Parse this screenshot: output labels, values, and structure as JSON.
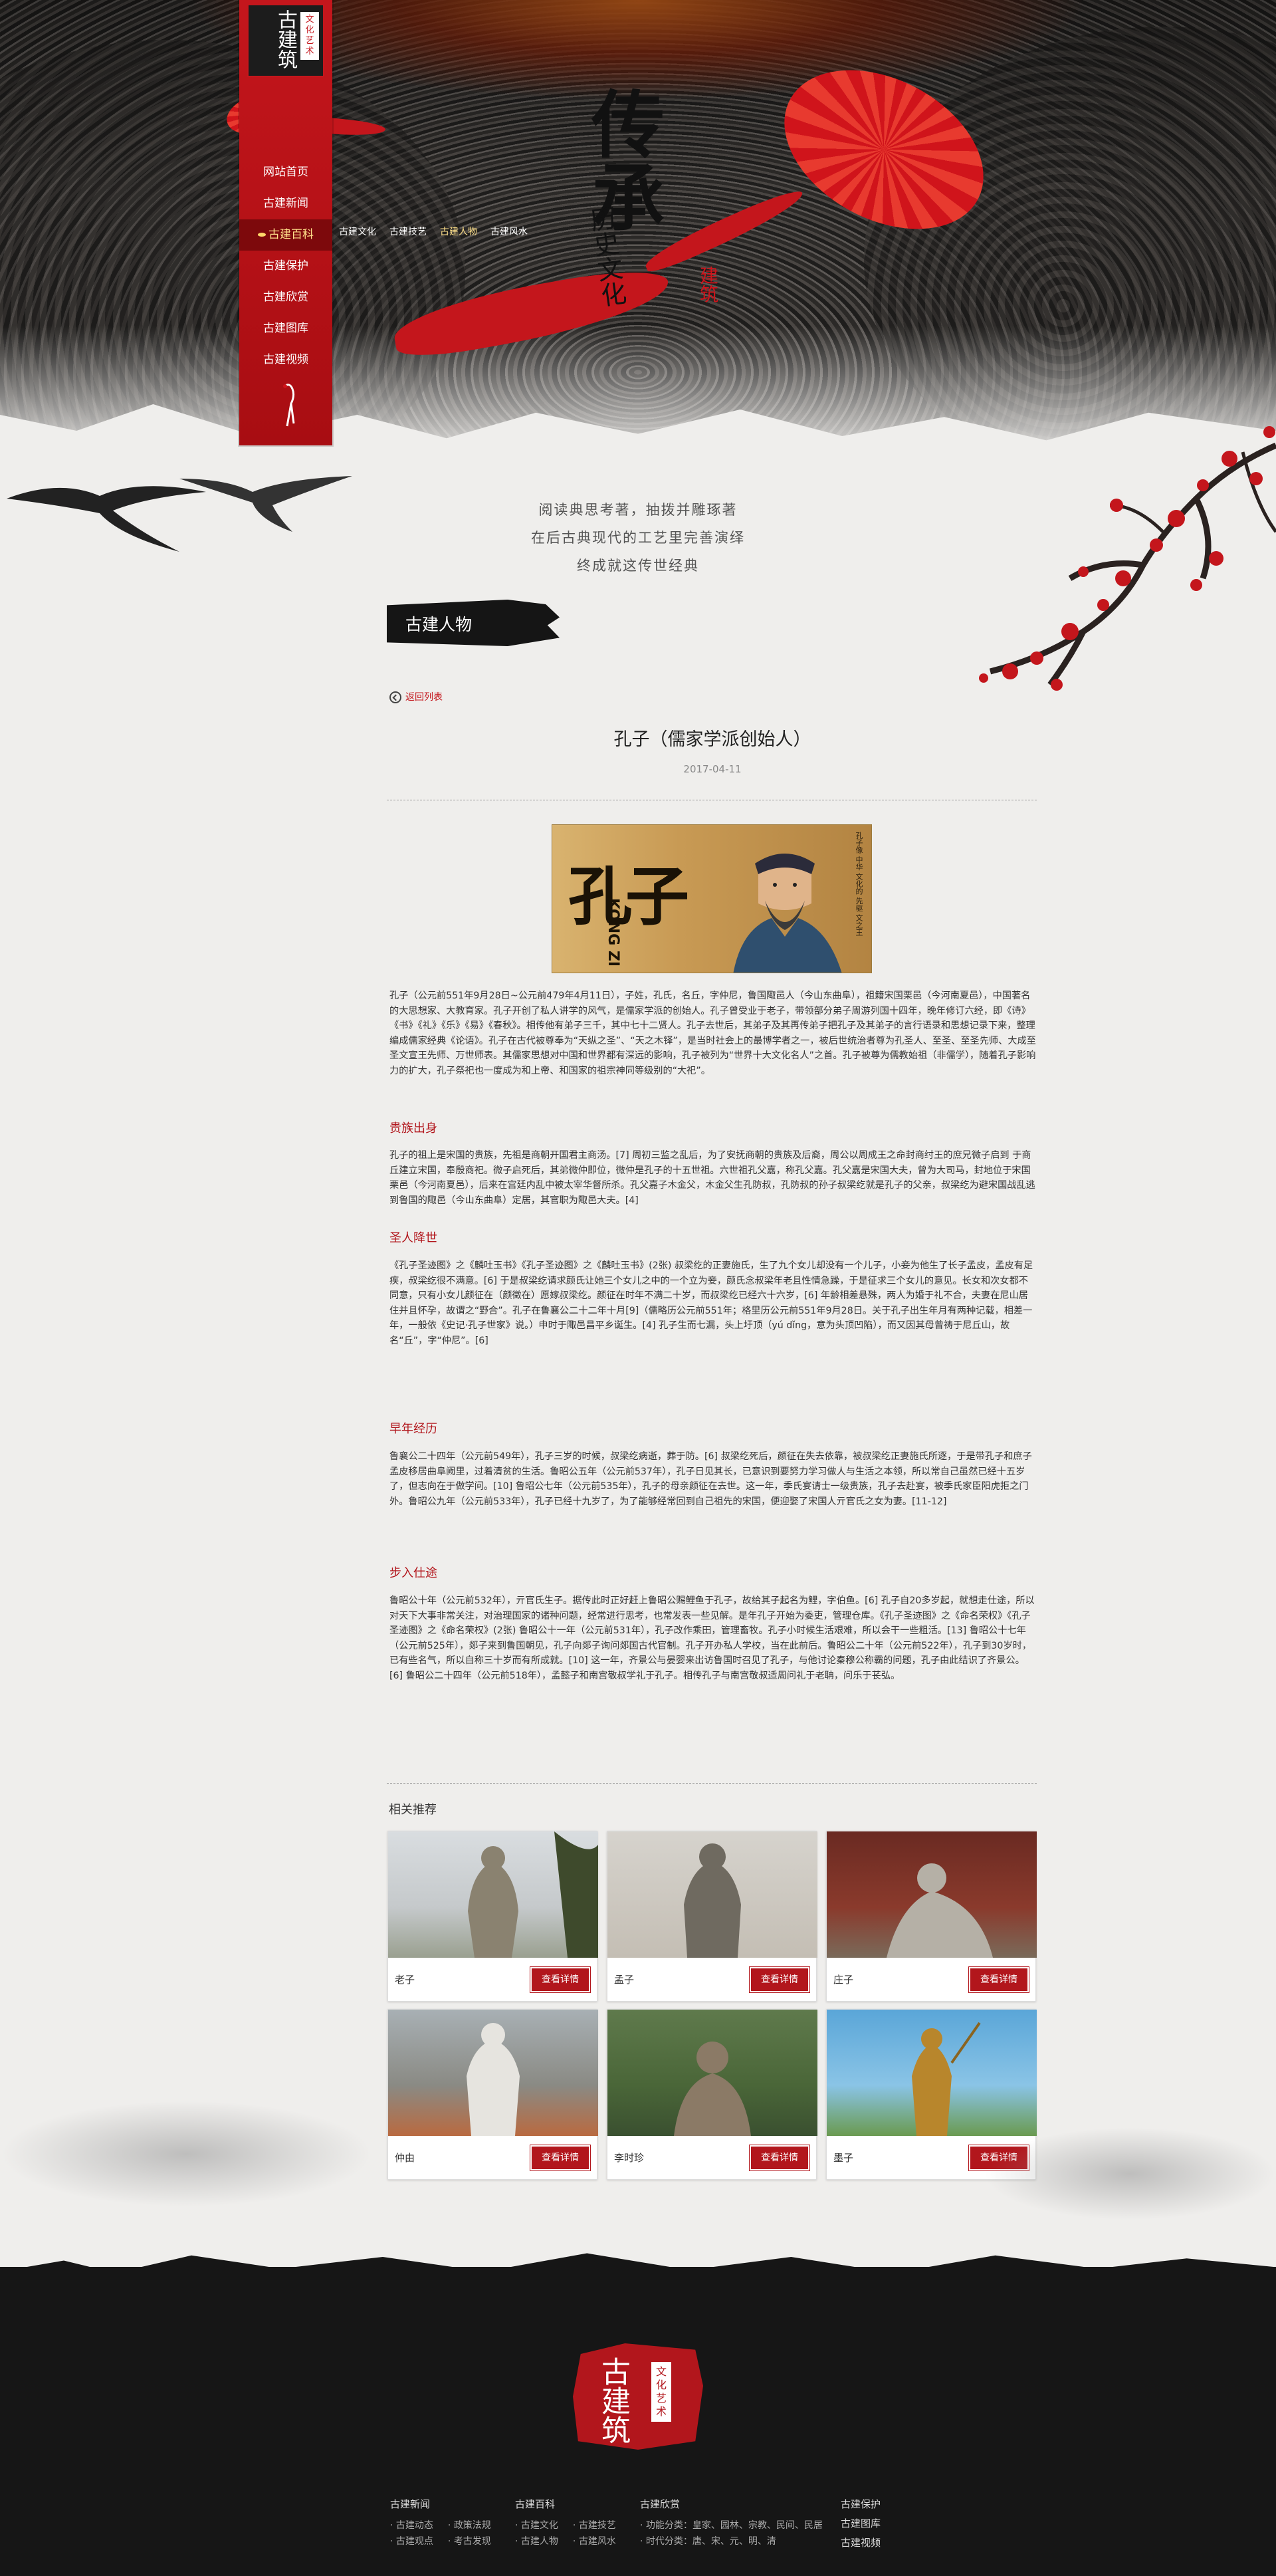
{
  "logo": {
    "main": "古建筑",
    "sub": "文化艺术"
  },
  "nav": {
    "items": [
      {
        "label": "网站首页"
      },
      {
        "label": "古建新闻"
      },
      {
        "label": "古建百科",
        "active": true
      },
      {
        "label": "古建保护"
      },
      {
        "label": "古建欣赏"
      },
      {
        "label": "古建图库"
      },
      {
        "label": "古建视频"
      }
    ],
    "subnav": [
      "古建文化",
      "古建技艺",
      "古建人物",
      "古建风水"
    ],
    "subnav_active": 2
  },
  "hero": {
    "big": "传承",
    "small": "历史文化",
    "stamp": "建筑"
  },
  "slogan": [
    "阅读典思考著，抽拨并雕琢著",
    "在后古典现代的工艺里完善演绎",
    "终成就这传世经典"
  ],
  "section": {
    "title": "古建人物",
    "back_label": "返回列表"
  },
  "article": {
    "title": "孔子（儒家学派创始人）",
    "date": "2017-04-11",
    "image": {
      "cn": "孔子",
      "en": "KONG ZI",
      "caption": "孔子像 中华 文化的 先驱 文之王"
    },
    "intro": "孔子（公元前551年9月28日~公元前479年4月11日），子姓，孔氏，名丘，字仲尼，鲁国陬邑人（今山东曲阜），祖籍宋国栗邑（今河南夏邑），中国著名的大思想家、大教育家。孔子开创了私人讲学的风气，是儒家学派的创始人。孔子曾受业于老子，带领部分弟子周游列国十四年，晚年修订六经，即《诗》《书》《礼》《乐》《易》《春秋》。相传他有弟子三千，其中七十二贤人。孔子去世后，其弟子及其再传弟子把孔子及其弟子的言行语录和思想记录下来，整理编成儒家经典《论语》。孔子在古代被尊奉为“天纵之圣”、“天之木铎”，是当时社会上的最博学者之一，被后世统治者尊为孔圣人、至圣、至圣先师、大成至圣文宣王先师、万世师表。其儒家思想对中国和世界都有深远的影响，孔子被列为“世界十大文化名人”之首。孔子被尊为儒教始祖（非儒学），随着孔子影响力的扩大，孔子祭祀也一度成为和上帝、和国家的祖宗神同等级别的“大祀”。",
    "sections": [
      {
        "heading": "贵族出身",
        "text": "孔子的祖上是宋国的贵族，先祖是商朝开国君主商汤。[7] 周初三监之乱后，为了安抚商朝的贵族及后裔，周公以周成王之命封商纣王的庶兄微子启到 于商丘建立宋国，奉殷商祀。微子启死后，其弟微仲即位，微仲是孔子的十五世祖。六世祖孔父嘉，称孔父嘉。孔父嘉是宋国大夫，曾为大司马，封地位于宋国栗邑（今河南夏邑），后来在宫廷内乱中被太宰华督所杀。孔父嘉子木金父，木金父生孔防叔，孔防叔的孙子叔梁纥就是孔子的父亲，叔梁纥为避宋国战乱逃到鲁国的陬邑（今山东曲阜）定居，其官职为陬邑大夫。[4]"
      },
      {
        "heading": "圣人降世",
        "text": "《孔子圣迹图》之《麟吐玉书》《孔子圣迹图》之《麟吐玉书》(2张) 叔梁纥的正妻施氏，生了九个女儿却没有一个儿子，小妾为他生了长子孟皮，孟皮有足疾，叔梁纥很不满意。[6] 于是叔梁纥请求颜氏让她三个女儿之中的一个立为妾，颜氏念叔梁年老且性情急躁，于是征求三个女儿的意见。长女和次女都不同意，只有小女儿颜征在（颜徵在）愿嫁叔梁纥。颜征在时年不满二十岁，而叔梁纥已经六十六岁，[6] 年龄相差悬殊，两人为婚于礼不合，夫妻在尼山居住并且怀孕，故谓之“野合”。孔子在鲁襄公二十二年十月[9]（儒略历公元前551年；格里历公元前551年9月28日。关于孔子出生年月有两种记载，相差一年，一般依《史记·孔子世家》说。）申时于陬邑昌平乡诞生。[4] 孔子生而七漏，头上圩顶（yú dǐng，意为头顶凹陷），而又因其母曾祷于尼丘山，故名“丘”，字“仲尼”。[6]"
      },
      {
        "heading": "早年经历",
        "text": "鲁襄公二十四年（公元前549年），孔子三岁的时候，叔梁纥病逝，葬于防。[6] 叔梁纥死后，颜征在失去依靠，被叔梁纥正妻施氏所逐，于是带孔子和庶子孟皮移居曲阜阙里，过着清贫的生活。鲁昭公五年（公元前537年），孔子日见其长，已意识到要努力学习做人与生活之本领，所以常自己虽然已经十五岁了，但志向在于做学问。[10] 鲁昭公七年（公元前535年），孔子的母亲颜征在去世。这一年，季氏宴请士一级贵族，孔子去赴宴，被季氏家臣阳虎拒之门外。鲁昭公九年（公元前533年），孔子已经十九岁了，为了能够经常回到自己祖先的宋国，便迎娶了宋国人亓官氏之女为妻。[11-12]"
      },
      {
        "heading": "步入仕途",
        "text": "鲁昭公十年（公元前532年），亓官氏生子。据传此时正好赶上鲁昭公赐鲤鱼于孔子，故给其子起名为鲤，字伯鱼。[6] 孔子自20多岁起，就想走仕途，所以对天下大事非常关注，对治理国家的诸种问题，经常进行思考，也常发表一些见解。是年孔子开始为委吏，管理仓库。《孔子圣迹图》之《命名荣权》《孔子圣迹图》之《命名荣权》(2张) 鲁昭公十一年（公元前531年），孔子改作乘田，管理畜牧。孔子小时候生活艰难，所以会干一些粗活。[13] 鲁昭公十七年（公元前525年），郯子来到鲁国朝见，孔子向郯子询问郯国古代官制。孔子开办私人学校，当在此前后。鲁昭公二十年（公元前522年），孔子到30岁时，已有些名气，所以自称三十岁而有所成就。[10] 这一年，齐景公与晏婴来出访鲁国时召见了孔子，与他讨论秦穆公称霸的问题，孔子由此结识了齐景公。[6] 鲁昭公二十四年（公元前518年），孟懿子和南宫敬叔学礼于孔子。相传孔子与南宫敬叔适周问礼于老聃，问乐于苌弘。"
      }
    ]
  },
  "related": {
    "title": "相关推荐",
    "button_label": "查看详情",
    "items": [
      {
        "name": "老子"
      },
      {
        "name": "孟子"
      },
      {
        "name": "庄子"
      },
      {
        "name": "仲由"
      },
      {
        "name": "李时珍"
      },
      {
        "name": "墨子"
      }
    ]
  },
  "footer": {
    "logo_main": "古建筑",
    "logo_sub": "文化艺术",
    "columns": [
      {
        "heading": "古建新闻",
        "links": [
          [
            "古建动态",
            "政策法规"
          ],
          [
            "古建观点",
            "考古发现"
          ]
        ]
      },
      {
        "heading": "古建百科",
        "links": [
          [
            "古建文化",
            "古建技艺"
          ],
          [
            "古建人物",
            "古建风水"
          ]
        ]
      },
      {
        "heading": "古建欣赏",
        "links": [
          [
            "功能分类：皇家、园林、宗教、民间、民居"
          ],
          [
            "时代分类：唐、宋、元、明、清"
          ]
        ]
      },
      {
        "heading": "古建保护",
        "links": []
      }
    ],
    "extra_headings": [
      "古建图库",
      "古建视频"
    ]
  },
  "colors": {
    "accent": "#c4161c",
    "footer_bg": "#161616",
    "page_bg": "#efeeec"
  }
}
